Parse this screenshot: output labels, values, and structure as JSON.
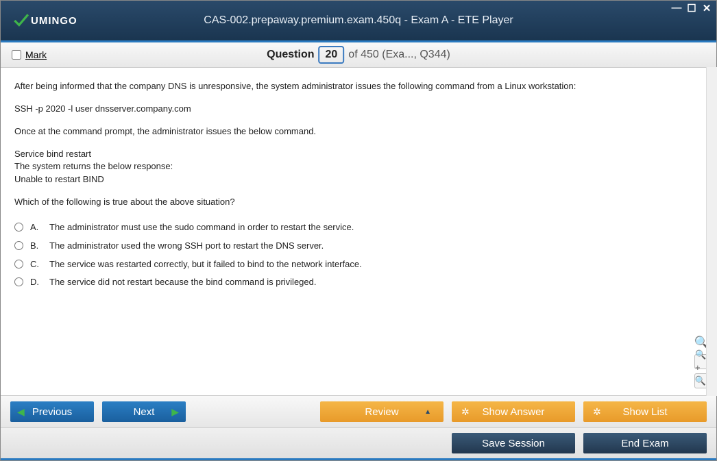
{
  "window": {
    "logo_text": "UMINGO",
    "title": "CAS-002.prepaway.premium.exam.450q - Exam A - ETE Player"
  },
  "header": {
    "mark_label": "Mark",
    "question_label": "Question",
    "current_number": "20",
    "total_suffix": "of 450 (Exa..., Q344)"
  },
  "question": {
    "p1": "After being informed that the company DNS is unresponsive, the system administrator issues the following command from a Linux workstation:",
    "p2": "SSH -p 2020 -l user dnsserver.company.com",
    "p3": "Once at the command prompt, the administrator issues the below command.",
    "p4_l1": "Service bind restart",
    "p4_l2": "The system returns the below response:",
    "p4_l3": "Unable to restart BIND",
    "p5": "Which of the following is true about the above situation?",
    "options": [
      {
        "letter": "A.",
        "text": "The administrator must use the sudo command in order to restart the service."
      },
      {
        "letter": "B.",
        "text": "The administrator used the wrong SSH port to restart the DNS server."
      },
      {
        "letter": "C.",
        "text": "The service was restarted correctly, but it failed to bind to the network interface."
      },
      {
        "letter": "D.",
        "text": "The service did not restart because the bind command is privileged."
      }
    ]
  },
  "buttons": {
    "previous": "Previous",
    "next": "Next",
    "review": "Review",
    "show_answer": "Show Answer",
    "show_list": "Show List",
    "save_session": "Save Session",
    "end_exam": "End Exam"
  }
}
